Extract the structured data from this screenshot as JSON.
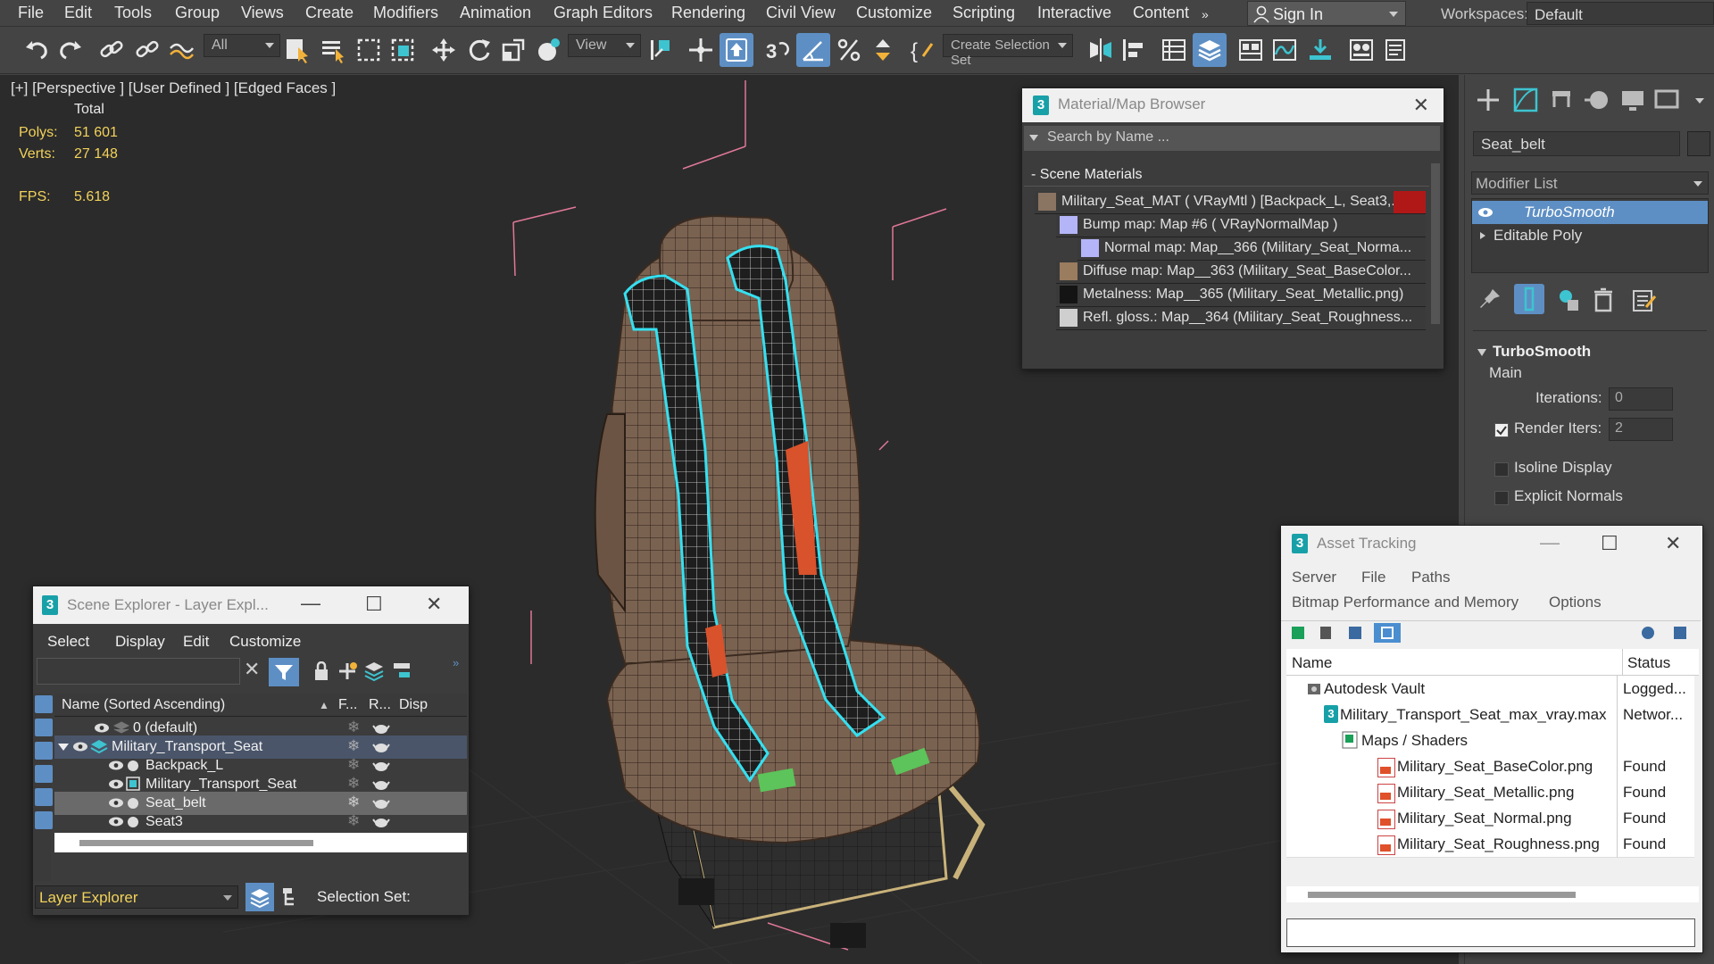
{
  "menubar": {
    "items": [
      "File",
      "Edit",
      "Tools",
      "Group",
      "Views",
      "Create",
      "Modifiers",
      "Animation",
      "Graph Editors",
      "Rendering",
      "Civil View",
      "Customize",
      "Scripting",
      "Interactive",
      "Content"
    ],
    "overflow": "»",
    "sign_in": "Sign In",
    "workspaces_label": "Workspaces:",
    "workspace_value": "Default"
  },
  "toolbar": {
    "filter_value": "All",
    "ref_coord_value": "View",
    "selection_set_placeholder": "Create Selection Set"
  },
  "viewport": {
    "label": "[+] [Perspective ] [User Defined ] [Edged Faces ]",
    "stats": {
      "total_label": "Total",
      "polys_label": "Polys:",
      "polys_value": "51 601",
      "verts_label": "Verts:",
      "verts_value": "27 148",
      "fps_label": "FPS:",
      "fps_value": "5.618"
    }
  },
  "command_panel": {
    "object_name": "Seat_belt",
    "modifier_list": "Modifier List",
    "stack": [
      "TurboSmooth",
      "Editable Poly"
    ],
    "rollout_title": "TurboSmooth",
    "main_label": "Main",
    "iterations_label": "Iterations:",
    "iterations_value": "0",
    "render_iters_label": "Render Iters:",
    "render_iters_value": "2",
    "isoline_label": "Isoline Display",
    "explicit_normals_label": "Explicit Normals"
  },
  "material_browser": {
    "title": "Material/Map Browser",
    "search_placeholder": "Search by Name ...",
    "section": "- Scene Materials",
    "rows": [
      "Military_Seat_MAT  ( VRayMtl )  [Backpack_L, Seat3,...",
      "Bump map: Map #6  ( VRayNormalMap )",
      "Normal  map: Map__366 (Military_Seat_Norma...",
      "Diffuse  map: Map__363 (Military_Seat_BaseColor...",
      "Metalness: Map__365 (Military_Seat_Metallic.png)",
      "Refl.  gloss.: Map__364 (Military_Seat_Roughness..."
    ]
  },
  "scene_explorer": {
    "title": "Scene Explorer - Layer Expl...",
    "menu": [
      "Select",
      "Display",
      "Edit",
      "Customize"
    ],
    "col_name": "Name (Sorted Ascending)",
    "col_f": "F...",
    "col_r": "R...",
    "col_d": "Disp",
    "rows": [
      {
        "name": "0 (default)"
      },
      {
        "name": "Military_Transport_Seat"
      },
      {
        "name": "Backpack_L"
      },
      {
        "name": "Military_Transport_Seat"
      },
      {
        "name": "Seat_belt"
      },
      {
        "name": "Seat3"
      }
    ],
    "footer_mode": "Layer Explorer",
    "selection_set_label": "Selection Set:"
  },
  "asset_tracking": {
    "title": "Asset Tracking",
    "menu_row1": [
      "Server",
      "File",
      "Paths"
    ],
    "menu_row2": [
      "Bitmap Performance and Memory",
      "Options"
    ],
    "col_name": "Name",
    "col_status": "Status",
    "rows": [
      {
        "name": "Autodesk Vault",
        "status": "Logged..."
      },
      {
        "name": "Military_Transport_Seat_max_vray.max",
        "status": "Networ..."
      },
      {
        "name": "Maps / Shaders",
        "status": ""
      },
      {
        "name": "Military_Seat_BaseColor.png",
        "status": "Found"
      },
      {
        "name": "Military_Seat_Metallic.png",
        "status": "Found"
      },
      {
        "name": "Military_Seat_Normal.png",
        "status": "Found"
      },
      {
        "name": "Military_Seat_Roughness.png",
        "status": "Found"
      }
    ]
  },
  "colors": {
    "accent": "#5e8fc4",
    "stat_text": "#f2d25a",
    "selection_outline": "#35e0f0",
    "layer_explorer_text": "#f2d25a"
  }
}
